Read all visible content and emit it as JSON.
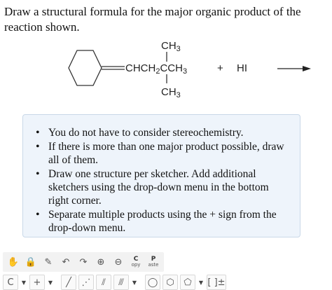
{
  "question": "Draw a structural formula for the major organic product of the reaction shown.",
  "reaction": {
    "top_group": "CH",
    "top_sub": "3",
    "main_chain_a": "CHCH",
    "main_sub_a": "2",
    "main_chain_b": "CCH",
    "main_sub_b": "3",
    "bottom_group": "CH",
    "bottom_sub": "3",
    "plus": "+",
    "reagent": "HI"
  },
  "notes": [
    "You do not have to consider stereochemistry.",
    "If there is more than one major product possible, draw all of them.",
    "Draw one structure per sketcher. Add additional sketchers using the drop-down menu in the bottom right corner.",
    "Separate multiple products using the + sign from the drop-down menu."
  ],
  "toolbar": {
    "copy_top": "C",
    "copy_bottom": "opy",
    "paste_top": "P",
    "paste_bottom": "aste",
    "element": "C",
    "plus": "+",
    "bracket": "[ ]±"
  }
}
